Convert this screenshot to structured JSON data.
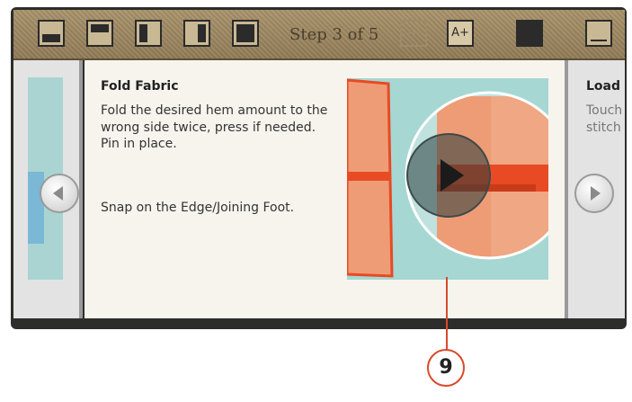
{
  "toolbar": {
    "step_label": "Step 3 of 5",
    "font_decrease_label": "A-",
    "font_increase_label": "A+"
  },
  "card": {
    "title": "Fold Fabric",
    "instruction": "Fold the desired hem amount to the wrong side twice, press if needed. Pin in place.",
    "note": "Snap on the Edge/Joining Foot."
  },
  "next_card": {
    "title": "Load",
    "body_line1": "Touch",
    "body_line2": "stitch"
  },
  "callout": {
    "number": "9"
  },
  "colors": {
    "toolbar_bg": "#a8926a",
    "fabric_orange": "#ee9c76",
    "fabric_edge": "#e84a23",
    "illustration_bg": "#a6d7d3",
    "callout_red": "#d94a2a"
  },
  "icons": {
    "prev": "chevron-left-icon",
    "next": "chevron-right-icon",
    "play": "play-icon"
  }
}
